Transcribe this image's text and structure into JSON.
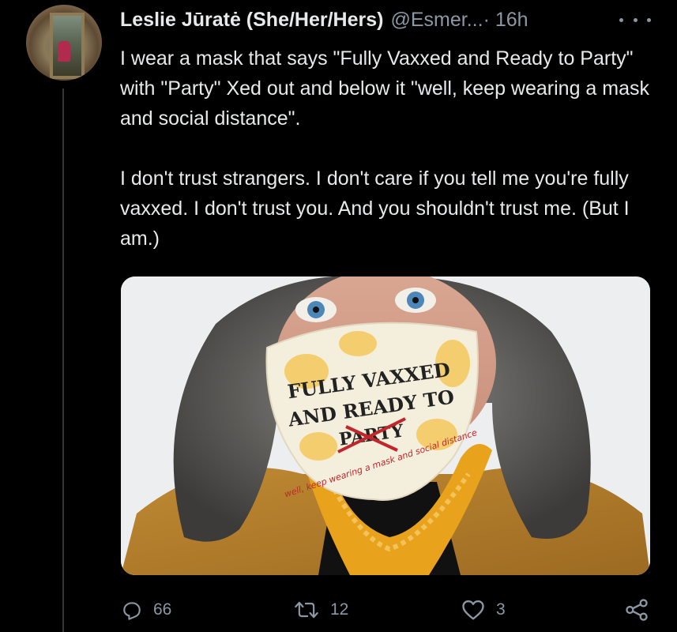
{
  "tweet": {
    "author_name": "Leslie Jūratė (She/Her/Hers)",
    "handle": "@Esmer...",
    "time": "· 16h",
    "paragraphs": [
      "I wear a mask that says \"Fully Vaxxed and Ready to Party\" with \"Party\" Xed out and below it \"well, keep wearing a mask and social distance\".",
      "I don't trust strangers. I don't care if you tell me you're fully vaxxed. I don't trust you. And you shouldn't trust me. (But I am.)"
    ],
    "media": {
      "mask_line_1": "FULLY VAXXED",
      "mask_line_2": "AND READY TO",
      "mask_line_3": "PARTY",
      "mask_script": "well, keep wearing a mask and social distance"
    }
  },
  "actions": {
    "replies": "66",
    "retweets": "12",
    "likes": "3"
  },
  "icons": {
    "more": "more-icon",
    "reply": "reply-icon",
    "retweet": "retweet-icon",
    "like": "heart-icon",
    "share": "share-icon"
  },
  "colors": {
    "background": "#000000",
    "text": "#e7e9ea",
    "secondary": "#8b98a5",
    "mask_print": "#222222",
    "mask_cross": "#c0262c",
    "scarf": "#e8a21c"
  }
}
